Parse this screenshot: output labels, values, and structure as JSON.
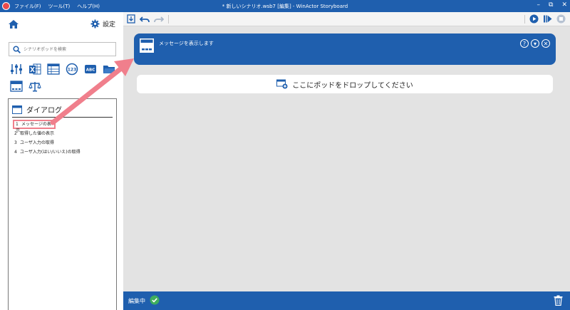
{
  "titlebar": {
    "menu": [
      "ファイル(F)",
      "ツール(T)",
      "ヘルプ(H)"
    ],
    "title": "* 新しいシナリオ.wsb7 [編集] - WinActor Storyboard",
    "controls": [
      "–",
      "⧉",
      "✕"
    ]
  },
  "left_panel": {
    "settings_label": "設定",
    "search_placeholder": "シナリオポッドを検索",
    "pod_icons": [
      "slider-icon",
      "excel-icon",
      "table-icon",
      "number-icon",
      "abc-icon",
      "folder-icon",
      "window-icon",
      "scale-icon"
    ],
    "dialog": {
      "title": "ダイアログ",
      "items": [
        {
          "num": "1",
          "label": "メッセージの表示"
        },
        {
          "num": "2",
          "label": "取得した値の表示"
        },
        {
          "num": "3",
          "label": "ユーザ入力の取得"
        },
        {
          "num": "4",
          "label": "ユーザ入力(はい/いいえ)の取得"
        }
      ]
    }
  },
  "main": {
    "message_pod_title": "メッセージを表示します",
    "drop_zone_label": "ここにポッドをドロップしてください"
  },
  "statusbar": {
    "status_text": "編集中"
  },
  "colors": {
    "brand_blue": "#1f5fae",
    "annotation_pink": "#f07f8c"
  }
}
